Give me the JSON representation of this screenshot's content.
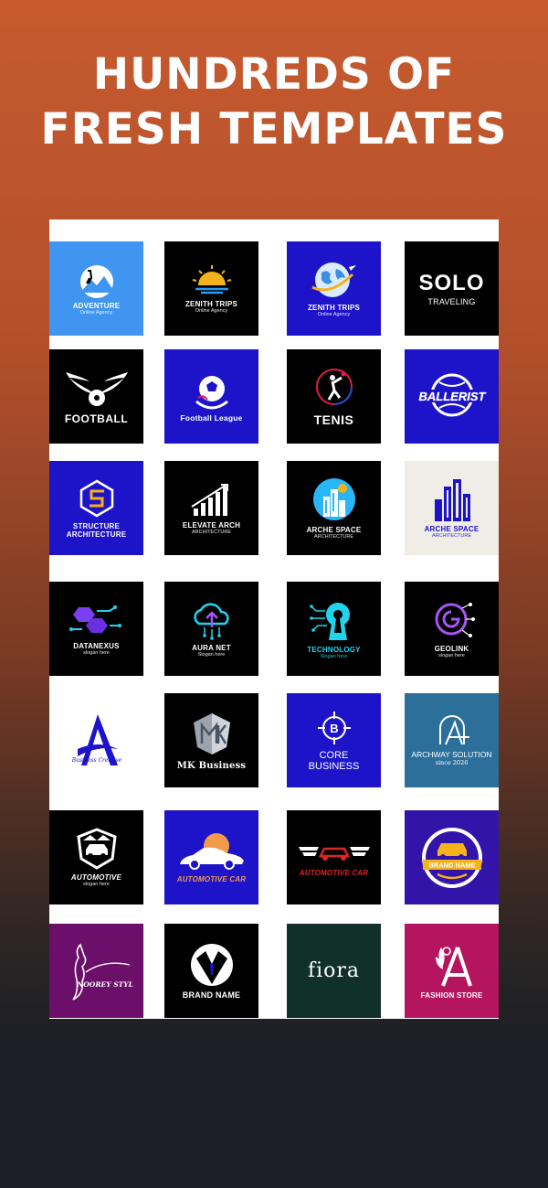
{
  "headline": {
    "line1": "HUNDREDS OF",
    "line2": "FRESH TEMPLATES"
  },
  "templates": [
    {
      "icon": "hiker-mountain-icon",
      "title": "ADVENTURE",
      "subtitle": "Online Agency",
      "bg": "#3f95ef"
    },
    {
      "icon": "sunrise-icon",
      "title": "ZENITH TRIPS",
      "subtitle": "Online Agency",
      "bg": "#000000"
    },
    {
      "icon": "globe-plane-icon",
      "title": "ZENITH TRIPS",
      "subtitle": "Online Agency",
      "bg": "#1d13c9"
    },
    {
      "icon": "solo-wordmark-icon",
      "title": "SOLO",
      "subtitle": "TRAVELING",
      "bg": "#000000"
    },
    {
      "icon": "winged-ball-icon",
      "title": "FOOTBALL",
      "subtitle": "",
      "bg": "#000000"
    },
    {
      "icon": "soccer-ball-icon",
      "title": "Football League",
      "subtitle": "",
      "bg": "#1d13c9"
    },
    {
      "icon": "tennis-player-icon",
      "title": "TENIS",
      "subtitle": "",
      "bg": "#000000"
    },
    {
      "icon": "ballerist-badge-icon",
      "title": "BALLERIST",
      "subtitle": "",
      "bg": "#1d13c9"
    },
    {
      "icon": "hexagon-s-icon",
      "title": "STRUCTURE",
      "subtitle": "ARCHITECTURE",
      "bg": "#1d13c9"
    },
    {
      "icon": "rising-bars-icon",
      "title": "ELEVATE ARCH",
      "subtitle": "ARCHITECTURE",
      "bg": "#000000"
    },
    {
      "icon": "buildings-circle-icon",
      "title": "ARCHE SPACE",
      "subtitle": "ARCHITECTURE",
      "bg": "#000000"
    },
    {
      "icon": "blue-buildings-icon",
      "title": "ARCHE SPACE",
      "subtitle": "ARCHITECTURE",
      "bg": "#f0ede6"
    },
    {
      "icon": "hex-circuit-icon",
      "title": "DATANEXUS",
      "subtitle": "slogan here",
      "bg": "#000000"
    },
    {
      "icon": "cloud-circuit-icon",
      "title": "AURA NET",
      "subtitle": "Slogan here",
      "bg": "#000000"
    },
    {
      "icon": "keyhole-circuit-icon",
      "title": "TECHNOLOGY",
      "subtitle": "Slogan here",
      "bg": "#000000"
    },
    {
      "icon": "geo-ring-icon",
      "title": "GEOLINK",
      "subtitle": "slogan here",
      "bg": "#000000"
    },
    {
      "icon": "letter-a-icon",
      "title": "Business Creative",
      "subtitle": "",
      "bg": "#ffffff"
    },
    {
      "icon": "mk-shield-icon",
      "title": "MK Business",
      "subtitle": "",
      "bg": "#000000"
    },
    {
      "icon": "target-b-icon",
      "title": "CORE",
      "subtitle": "BUSINESS",
      "bg": "#1d13c9"
    },
    {
      "icon": "arch-a-icon",
      "title": "ARCHWAY SOLUTION",
      "subtitle": "since 2026",
      "bg": "#2c6f9b"
    },
    {
      "icon": "car-shield-icon",
      "title": "AUTOMOTIVE",
      "subtitle": "slogan here",
      "bg": "#000000"
    },
    {
      "icon": "sports-car-icon",
      "title": "AUTOMOTIVE CAR",
      "subtitle": "",
      "bg": "#1d13c9"
    },
    {
      "icon": "winged-car-icon",
      "title": "AUTOMOTIVE CAR",
      "subtitle": "",
      "bg": "#000000"
    },
    {
      "icon": "car-badge-icon",
      "title": "BRAND NAME",
      "subtitle": "",
      "bg": "#3314a8"
    },
    {
      "icon": "woman-silhouette-icon",
      "title": "NOOREY STYLE",
      "subtitle": "",
      "bg": "#6b0f6a"
    },
    {
      "icon": "tuxedo-icon",
      "title": "BRAND NAME",
      "subtitle": "",
      "bg": "#000000"
    },
    {
      "icon": "flora-script-icon",
      "title": "fiora",
      "subtitle": "",
      "bg": "#12302a"
    },
    {
      "icon": "fashion-a-icon",
      "title": "FASHION STORE",
      "subtitle": "",
      "bg": "#b5145f"
    }
  ]
}
